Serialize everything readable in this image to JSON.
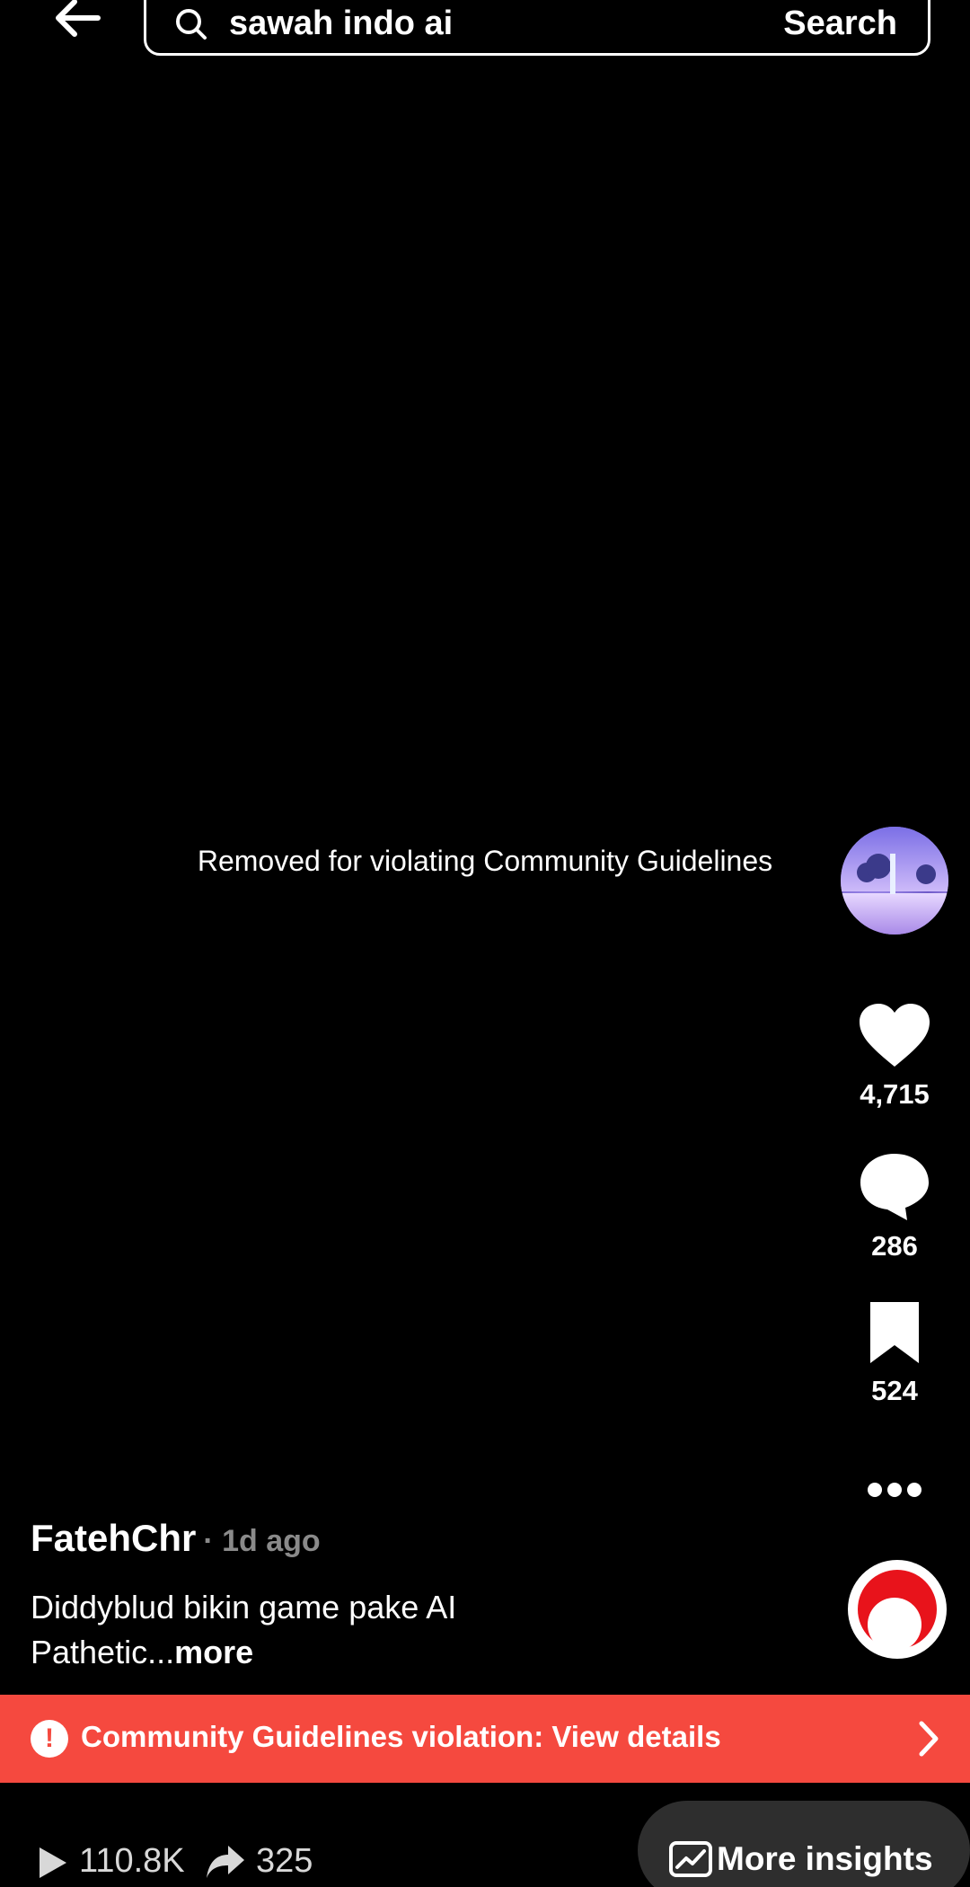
{
  "search": {
    "query": "sawah indo ai",
    "button_label": "Search"
  },
  "video": {
    "removed_notice": "Removed for violating Community Guidelines"
  },
  "rail": {
    "likes": "4,715",
    "comments": "286",
    "saves": "524"
  },
  "post": {
    "author": "FatehChr",
    "time": "· 1d ago",
    "caption_line1": "Diddyblud bikin game pake AI",
    "caption_line2": "Pathetic...",
    "more_label": "more"
  },
  "violation": {
    "text": "Community Guidelines violation: View details"
  },
  "stats": {
    "views": "110.8K",
    "shares": "325",
    "insights_label": "More insights"
  },
  "icons": {
    "back": "arrow-left-icon",
    "search": "search-icon",
    "like": "heart-icon",
    "comment": "comment-bubble-icon",
    "save": "bookmark-icon",
    "more": "more-dots-icon",
    "sound": "music-disc-icon",
    "warning": "exclamation-icon",
    "chevron": "chevron-right-icon",
    "play": "play-icon",
    "share": "share-arrow-icon",
    "insights": "chart-trend-icon"
  },
  "colors": {
    "background": "#000000",
    "violation_banner": "#f5493f",
    "insights_button": "#2e2e2e"
  }
}
